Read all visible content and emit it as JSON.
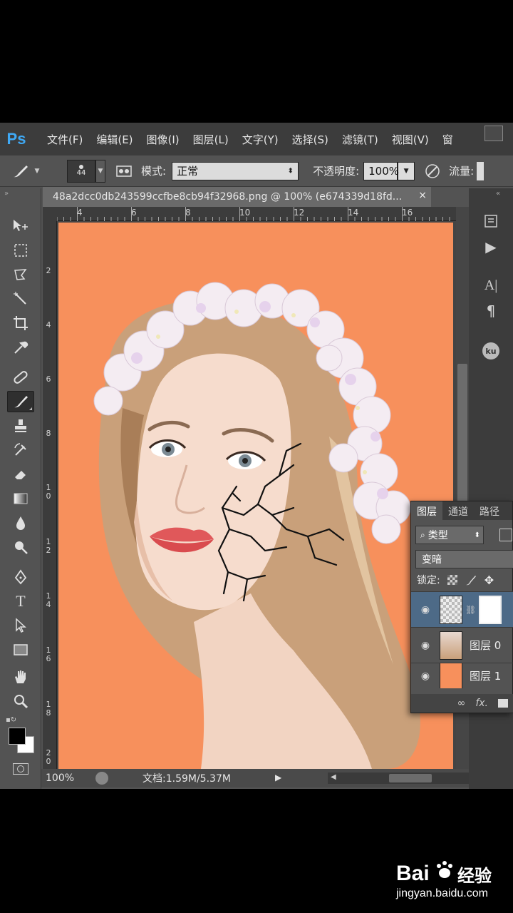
{
  "app": {
    "logo": "Ps"
  },
  "menu": [
    "文件(F)",
    "编辑(E)",
    "图像(I)",
    "图层(L)",
    "文字(Y)",
    "选择(S)",
    "滤镜(T)",
    "视图(V)",
    "窗"
  ],
  "options": {
    "brush_size": "44",
    "mode_label": "模式:",
    "mode_value": "正常",
    "opacity_label": "不透明度:",
    "opacity_value": "100%",
    "flow_label": "流量:"
  },
  "document": {
    "tab_title": "48a2dcc0db243599ccfbe8cb94f32968.png @ 100% (e674339d18fd...",
    "close_glyph": "×",
    "ruler_h_labels": [
      "4",
      "6",
      "8",
      "10",
      "12",
      "14",
      "16"
    ],
    "ruler_v_labels": [
      "2",
      "4",
      "6",
      "8",
      "10",
      "12",
      "14",
      "16",
      "18",
      "20"
    ],
    "background_color": "#f7905c"
  },
  "status": {
    "zoom": "100%",
    "doc_info": "文档:1.59M/5.37M"
  },
  "layers_panel": {
    "tabs": [
      "图层",
      "通道",
      "路径"
    ],
    "filter_label": "类型",
    "blend_mode": "变暗",
    "lock_label": "锁定:",
    "layers": [
      {
        "name": "",
        "selected": true
      },
      {
        "name": "图层 0",
        "selected": false
      },
      {
        "name": "图层 1",
        "selected": false
      }
    ],
    "footer": [
      "fx."
    ]
  },
  "watermark": {
    "brand_text": "经验",
    "url": "jingyan.baidu.com"
  }
}
